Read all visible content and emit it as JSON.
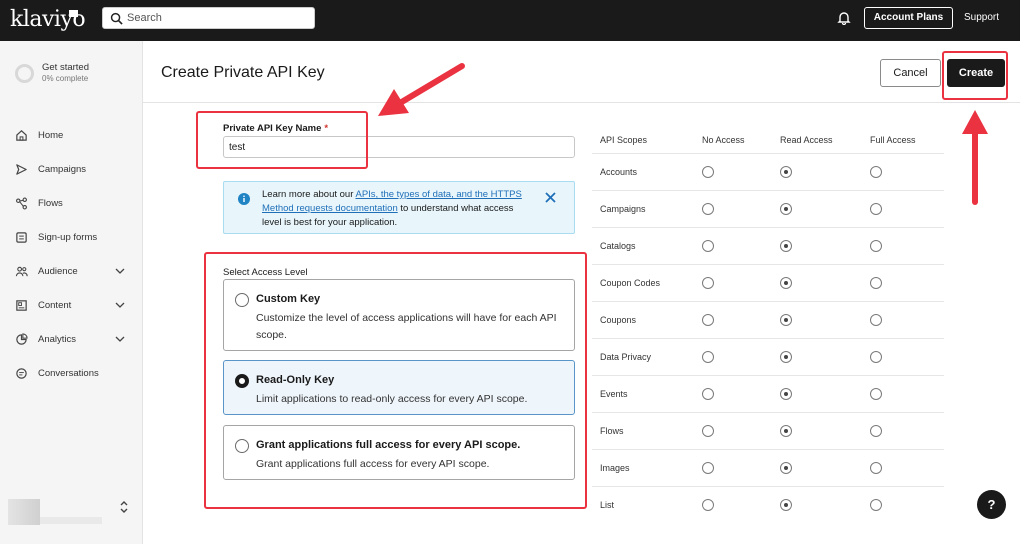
{
  "topbar": {
    "logo": "klaviyo",
    "search_placeholder": "Search",
    "account_plans_label": "Account Plans",
    "support_label": "Support"
  },
  "sidebar": {
    "get_started_title": "Get started",
    "get_started_progress": "0% complete",
    "items": [
      {
        "label": "Home",
        "icon": "home-icon",
        "expandable": false
      },
      {
        "label": "Campaigns",
        "icon": "send-icon",
        "expandable": false
      },
      {
        "label": "Flows",
        "icon": "flows-icon",
        "expandable": false
      },
      {
        "label": "Sign-up forms",
        "icon": "form-icon",
        "expandable": false
      },
      {
        "label": "Audience",
        "icon": "people-icon",
        "expandable": true
      },
      {
        "label": "Content",
        "icon": "content-icon",
        "expandable": true
      },
      {
        "label": "Analytics",
        "icon": "chart-icon",
        "expandable": true
      },
      {
        "label": "Conversations",
        "icon": "chat-icon",
        "expandable": false
      }
    ]
  },
  "page": {
    "title": "Create Private API Key",
    "cancel_label": "Cancel",
    "create_label": "Create"
  },
  "form": {
    "name_label": "Private API Key Name",
    "required_mark": "*",
    "name_value": "test",
    "info": {
      "prefix": "Learn more about our ",
      "link": "APIs, the types of data, and the HTTPS Method requests documentation",
      "suffix": " to understand what access level is best for your application."
    },
    "access_level_label": "Select Access Level",
    "options": [
      {
        "title": "Custom Key",
        "desc": "Customize the level of access applications will have for each API scope.",
        "selected": false
      },
      {
        "title": "Read-Only Key",
        "desc": "Limit applications to read-only access for every API scope.",
        "selected": true
      },
      {
        "title": "Grant applications full access for every API scope.",
        "desc": "Grant applications full access for every API scope.",
        "selected": false
      }
    ]
  },
  "scopes": {
    "headers": [
      "API Scopes",
      "No Access",
      "Read Access",
      "Full Access"
    ],
    "rows": [
      {
        "name": "Accounts",
        "level": "Read Access"
      },
      {
        "name": "Campaigns",
        "level": "Read Access"
      },
      {
        "name": "Catalogs",
        "level": "Read Access"
      },
      {
        "name": "Coupon Codes",
        "level": "Read Access"
      },
      {
        "name": "Coupons",
        "level": "Read Access"
      },
      {
        "name": "Data Privacy",
        "level": "Read Access"
      },
      {
        "name": "Events",
        "level": "Read Access"
      },
      {
        "name": "Flows",
        "level": "Read Access"
      },
      {
        "name": "Images",
        "level": "Read Access"
      },
      {
        "name": "List",
        "level": "Read Access"
      }
    ]
  },
  "help_label": "?",
  "colors": {
    "annotation": "#ea3241",
    "brand_dark": "#1a1a1a",
    "link": "#1f6fb8",
    "info_bg": "#e8f6fc"
  }
}
